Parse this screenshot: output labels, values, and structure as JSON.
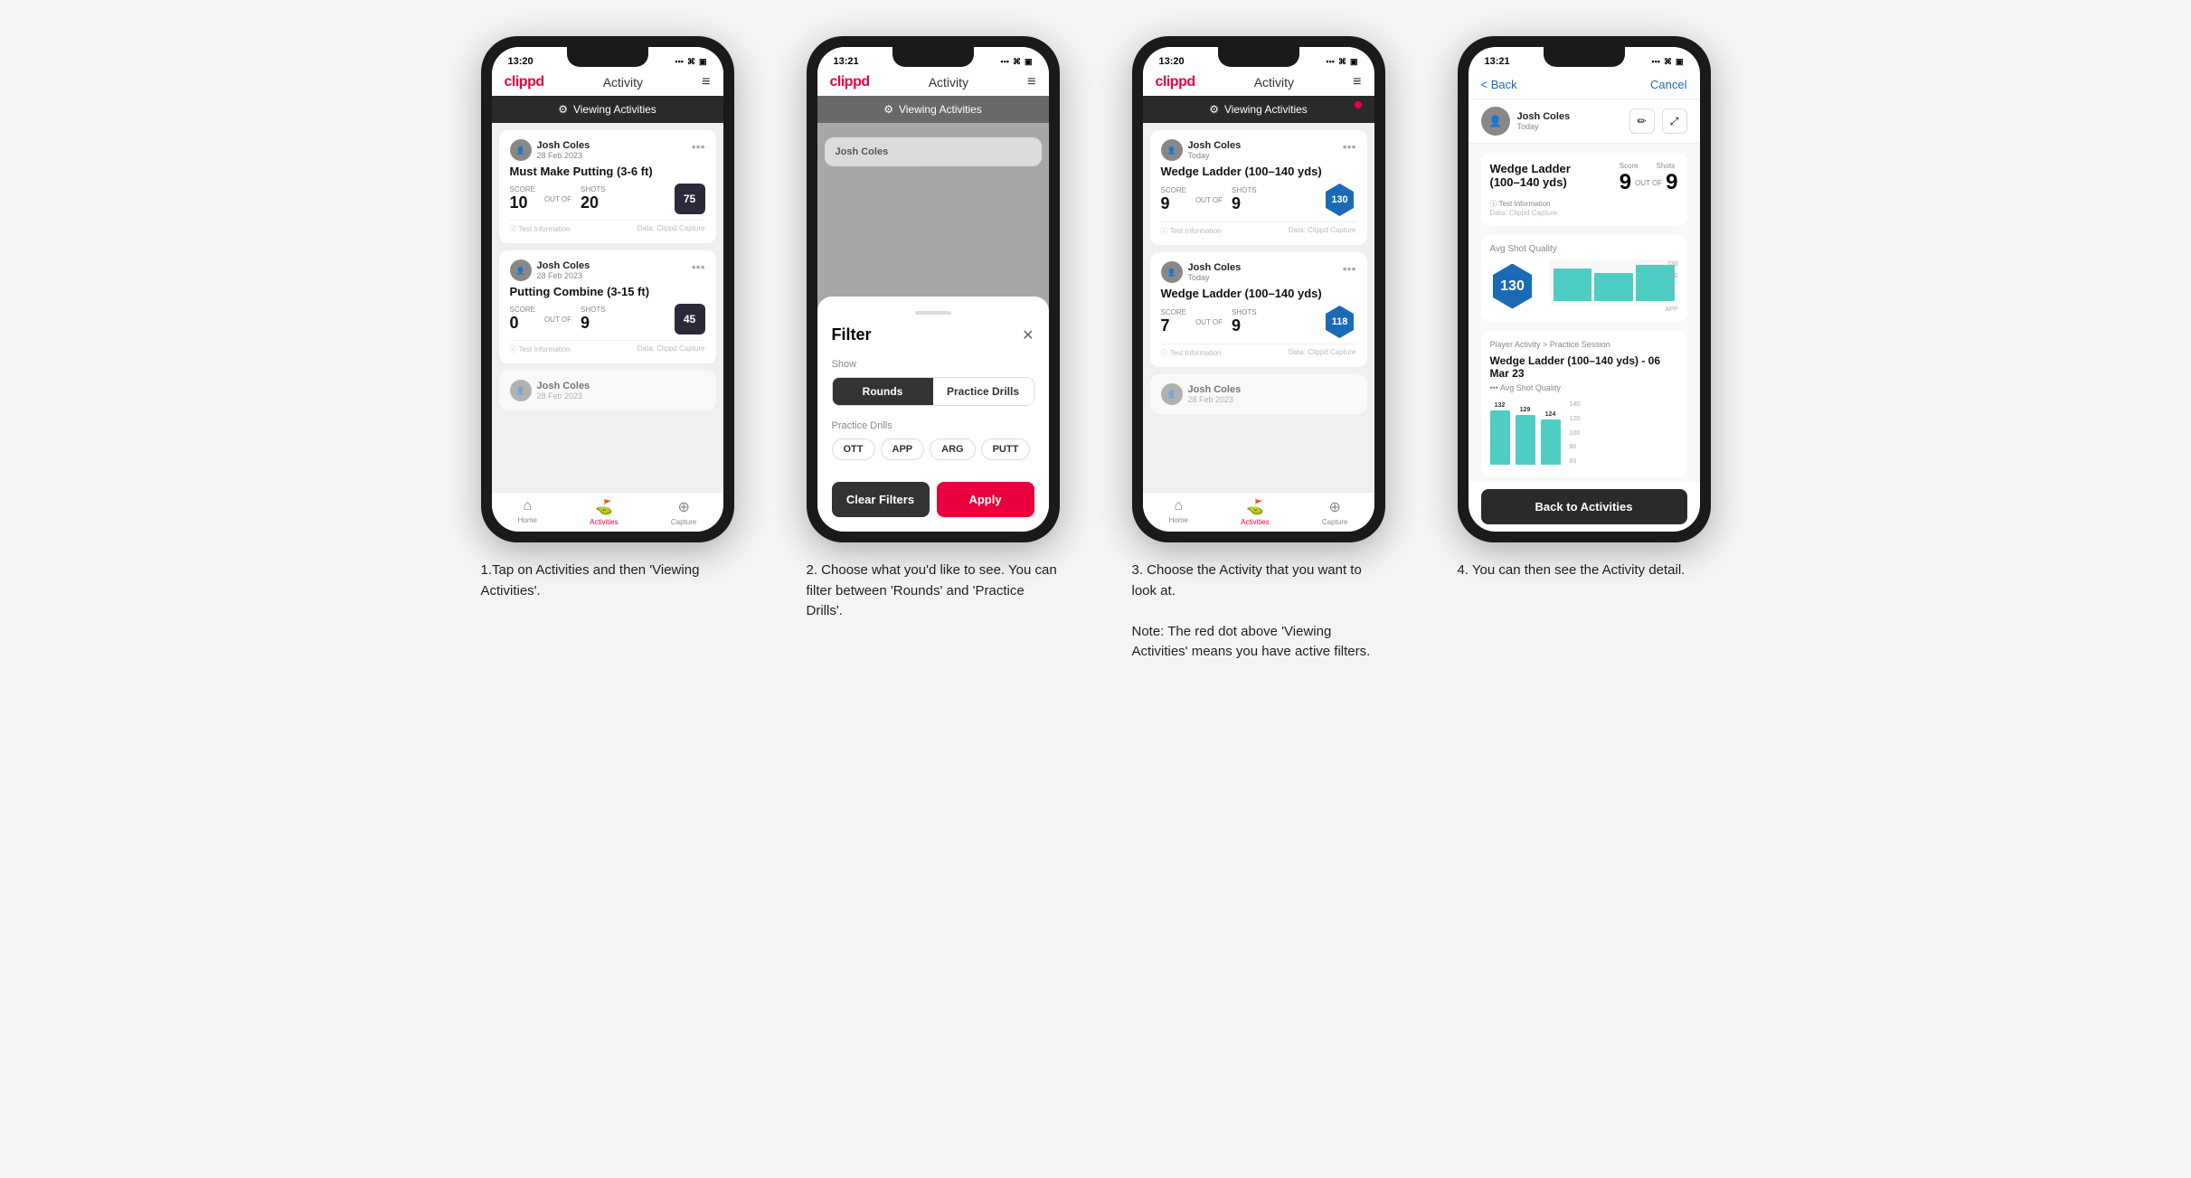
{
  "app": {
    "logo": "clippd",
    "nav_title": "Activity",
    "menu_icon": "≡"
  },
  "phones": [
    {
      "id": "phone1",
      "status_time": "13:20",
      "viewing_banner": "Viewing Activities",
      "has_red_dot": false,
      "cards": [
        {
          "user": "Josh Coles",
          "date": "28 Feb 2023",
          "title": "Must Make Putting (3-6 ft)",
          "score_label": "Score",
          "score": "10",
          "shots_label": "Shots",
          "shots": "20",
          "shot_quality_label": "Shot Quality",
          "shot_quality": "75",
          "info": "Test Information",
          "data_source": "Data: Clippd Capture",
          "badge_type": "square"
        },
        {
          "user": "Josh Coles",
          "date": "28 Feb 2023",
          "title": "Putting Combine (3-15 ft)",
          "score_label": "Score",
          "score": "0",
          "shots_label": "Shots",
          "shots": "9",
          "shot_quality_label": "Shot Quality",
          "shot_quality": "45",
          "info": "Test Information",
          "data_source": "Data: Clippd Capture",
          "badge_type": "square"
        },
        {
          "user": "Josh Coles",
          "date": "28 Feb 2023",
          "title": "",
          "partial": true
        }
      ],
      "bottom_nav": [
        "Home",
        "Activities",
        "Capture"
      ],
      "active_nav": 1
    },
    {
      "id": "phone2",
      "status_time": "13:21",
      "viewing_banner": "Viewing Activities",
      "has_red_dot": false,
      "modal": {
        "title": "Filter",
        "show_label": "Show",
        "toggle_options": [
          "Rounds",
          "Practice Drills"
        ],
        "active_toggle": 0,
        "practice_drills_label": "Practice Drills",
        "filter_tags": [
          "OTT",
          "APP",
          "ARG",
          "PUTT"
        ],
        "clear_btn": "Clear Filters",
        "apply_btn": "Apply"
      },
      "partial_card": {
        "user": "Josh Coles",
        "date": ""
      }
    },
    {
      "id": "phone3",
      "status_time": "13:20",
      "viewing_banner": "Viewing Activities",
      "has_red_dot": true,
      "cards": [
        {
          "user": "Josh Coles",
          "date": "Today",
          "title": "Wedge Ladder (100–140 yds)",
          "score_label": "Score",
          "score": "9",
          "shots_label": "Shots",
          "shots": "9",
          "shot_quality_label": "Shot Quality",
          "shot_quality": "130",
          "info": "Test Information",
          "data_source": "Data: Clippd Capture",
          "badge_type": "hex"
        },
        {
          "user": "Josh Coles",
          "date": "Today",
          "title": "Wedge Ladder (100–140 yds)",
          "score_label": "Score",
          "score": "7",
          "shots_label": "Shots",
          "shots": "9",
          "shot_quality_label": "Shot Quality",
          "shot_quality": "118",
          "info": "Test Information",
          "data_source": "Data: Clippd Capture",
          "badge_type": "hex"
        },
        {
          "user": "Josh Coles",
          "date": "28 Feb 2023",
          "title": "",
          "partial": true
        }
      ],
      "bottom_nav": [
        "Home",
        "Activities",
        "Capture"
      ],
      "active_nav": 1
    },
    {
      "id": "phone4",
      "status_time": "13:21",
      "back_btn": "< Back",
      "cancel_btn": "Cancel",
      "detail_user": "Josh Coles",
      "detail_date": "Today",
      "detail_title": "Wedge Ladder (100–140 yds)",
      "score_label": "Score",
      "score": "9",
      "out_of_label": "OUT OF",
      "out_of": "9",
      "shots_label": "Shots",
      "info_label": "Test Information",
      "data_label": "Data: Clippd Capture",
      "avg_shot_quality_label": "Avg Shot Quality",
      "shot_quality_value": "130",
      "chart_bars": [
        132,
        129,
        124
      ],
      "chart_max": 140,
      "chart_y_labels": [
        "140",
        "100",
        "50",
        "0"
      ],
      "chart_x_label": "APP",
      "practice_session_label": "Player Activity > Practice Session",
      "practice_session_title": "Wedge Ladder (100–140 yds) - 06 Mar 23",
      "back_to_activities": "Back to Activities"
    }
  ],
  "captions": [
    "1.Tap on Activities and then 'Viewing Activities'.",
    "2. Choose what you'd like to see. You can filter between 'Rounds' and 'Practice Drills'.",
    "3. Choose the Activity that you want to look at.\n\nNote: The red dot above 'Viewing Activities' means you have active filters.",
    "4. You can then see the Activity detail."
  ]
}
